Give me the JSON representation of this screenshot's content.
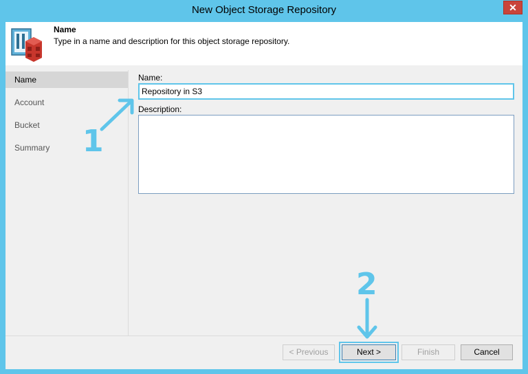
{
  "window": {
    "title": "New Object Storage Repository",
    "close_glyph": "✕"
  },
  "header": {
    "step_title": "Name",
    "step_description": "Type in a name and description for this object storage repository."
  },
  "nav": {
    "items": [
      "Name",
      "Account",
      "Bucket",
      "Summary"
    ],
    "active": "Name"
  },
  "form": {
    "name_label": "Name:",
    "name_value": "Repository in S3",
    "description_label": "Description:",
    "description_value": ""
  },
  "buttons": {
    "previous": "< Previous",
    "next": "Next >",
    "finish": "Finish",
    "cancel": "Cancel"
  },
  "annotations": {
    "marker_1": "1",
    "marker_2": "2"
  },
  "colors": {
    "accent": "#5fc5ea",
    "close": "#c9443a",
    "logo_red": "#c7362c"
  }
}
